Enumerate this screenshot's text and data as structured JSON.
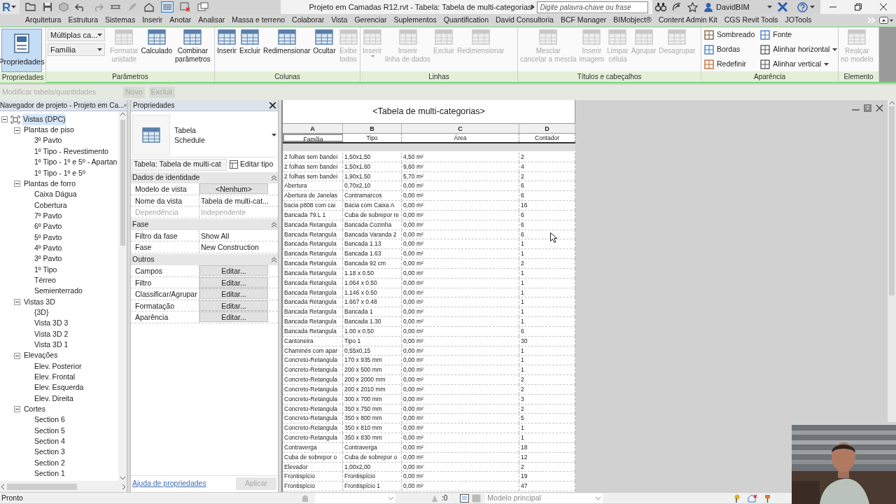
{
  "app_button": {
    "label": "R"
  },
  "window": {
    "title": "Projeto em Camadas R12.rvt - Tabela: Tabela de multi-categorias"
  },
  "search": {
    "placeholder": "Digite palavra-chave ou frase"
  },
  "user": {
    "name": "DavidBIM"
  },
  "ribbon_tabs": [
    "Arquitetura",
    "Estrutura",
    "Sistemas",
    "Inserir",
    "Anotar",
    "Analisar",
    "Massa e terreno",
    "Colaborar",
    "Vista",
    "Gerenciar",
    "Suplementos",
    "Quantification",
    "David Consultoria",
    "BCF Manager",
    "BIMobject®",
    "Content Admin Kit",
    "CGS Revit Tools",
    "JOTools"
  ],
  "ribbon_panels": [
    {
      "title": "Propriedades",
      "tools": [
        {
          "kind": "toggle",
          "label": "Propriedades",
          "on": true
        }
      ]
    },
    {
      "title": "Parâmetros",
      "tools": [
        {
          "kind": "dropdown",
          "value": "Múltiplas ca..."
        },
        {
          "kind": "dropdown",
          "value": "Família"
        },
        {
          "kind": "large",
          "label": "Formatar\nunidade",
          "disabled": true
        },
        {
          "kind": "large",
          "label": "Calculado",
          "disabled": false
        },
        {
          "kind": "large",
          "label": "Combinar\nparâmetros",
          "disabled": false
        }
      ]
    },
    {
      "title": "Colunas",
      "tools": [
        {
          "kind": "large",
          "label": "Inserir",
          "disabled": false
        },
        {
          "kind": "large",
          "label": "Excluir",
          "disabled": false
        },
        {
          "kind": "large",
          "label": "Redimensionar",
          "disabled": false
        },
        {
          "kind": "large",
          "label": "Ocultar",
          "disabled": false
        },
        {
          "kind": "large",
          "label": "Exibir\ntodos",
          "disabled": true
        }
      ]
    },
    {
      "title": "Linhas",
      "tools": [
        {
          "kind": "large_menu",
          "label": "Inserir",
          "disabled": true
        },
        {
          "kind": "large",
          "label": "Inserir\nlinha de dados",
          "disabled": true
        },
        {
          "kind": "large",
          "label": "Excluir",
          "disabled": true
        },
        {
          "kind": "large",
          "label": "Redimensionar",
          "disabled": true
        }
      ]
    },
    {
      "title": "Títulos e cabeçalhos",
      "tools": [
        {
          "kind": "large",
          "label": "Mesclar\ncancelar a mescla",
          "disabled": true
        },
        {
          "kind": "large",
          "label": "Inserir\nimagem",
          "disabled": true
        },
        {
          "kind": "large",
          "label": "Limpar\ncélula",
          "disabled": true
        },
        {
          "kind": "large",
          "label": "Agrupar",
          "disabled": true
        },
        {
          "kind": "large",
          "label": "Desagrupar",
          "disabled": true
        }
      ]
    },
    {
      "title": "Aparência",
      "tools": [
        {
          "kind": "small",
          "label": "Sombreado",
          "caret": false
        },
        {
          "kind": "small",
          "label": "Bordas",
          "caret": false
        },
        {
          "kind": "small",
          "label": "Redefinir",
          "caret": false
        },
        {
          "kind": "small",
          "label": "Fonte",
          "caret": false
        },
        {
          "kind": "small",
          "label": "Alinhar horizontal",
          "caret": true
        },
        {
          "kind": "small",
          "label": "Alinhar vertical",
          "caret": true
        }
      ]
    },
    {
      "title": "Elemento",
      "tools": [
        {
          "kind": "large",
          "label": "Realçar\nno modelo",
          "disabled": true
        }
      ]
    }
  ],
  "context_bar": {
    "title": "Modificar tabela/quantidades",
    "disabled": true,
    "buttons": [
      {
        "label": "Novo",
        "disabled": true
      },
      {
        "label": "Excluir",
        "disabled": true
      }
    ]
  },
  "navigator": {
    "title": "Navegador de projeto - Projeto em Ca...",
    "tree": [
      {
        "label": "Vistas (DPC)",
        "selected": true,
        "expanded": true,
        "children": [
          {
            "label": "Plantas de piso",
            "selected": false,
            "expanded": true,
            "children": [
              {
                "label": "3º Pavto",
                "selected": false
              },
              {
                "label": "1º Tipo - Revestimento",
                "selected": false
              },
              {
                "label": "1º Tipo - 1º e 5º - Apartan",
                "selected": false
              },
              {
                "label": "1º Tipo - 1º e 5º",
                "selected": false
              }
            ]
          },
          {
            "label": "Plantas de forro",
            "selected": false,
            "expanded": true,
            "children": [
              {
                "label": "Caixa Dágua",
                "selected": false
              },
              {
                "label": "Cobertura",
                "selected": false
              },
              {
                "label": "7º Pavto",
                "selected": false
              },
              {
                "label": "6º Pavto",
                "selected": false
              },
              {
                "label": "5º Pavto",
                "selected": false
              },
              {
                "label": "4º Pavto",
                "selected": false
              },
              {
                "label": "3º Pavto",
                "selected": false
              },
              {
                "label": "1º Tipo",
                "selected": false
              },
              {
                "label": "Térreo",
                "selected": false
              },
              {
                "label": "Semienterrado",
                "selected": false
              }
            ]
          },
          {
            "label": "Vistas 3D",
            "selected": false,
            "expanded": true,
            "children": [
              {
                "label": "{3D}",
                "selected": false
              },
              {
                "label": "Vista 3D 3",
                "selected": false
              },
              {
                "label": "Vista 3D 2",
                "selected": false
              },
              {
                "label": "Vista 3D 1",
                "selected": false
              }
            ]
          },
          {
            "label": "Elevações",
            "selected": false,
            "expanded": true,
            "children": [
              {
                "label": "Elev. Posterior",
                "selected": false
              },
              {
                "label": "Elev. Frontal",
                "selected": false
              },
              {
                "label": "Elev. Esquerda",
                "selected": false
              },
              {
                "label": "Elev. Direita",
                "selected": false
              }
            ]
          },
          {
            "label": "Cortes",
            "selected": false,
            "expanded": true,
            "children": [
              {
                "label": "Section 6",
                "selected": false
              },
              {
                "label": "Section 5",
                "selected": false
              },
              {
                "label": "Section 4",
                "selected": false
              },
              {
                "label": "Section 3",
                "selected": false
              },
              {
                "label": "Section 2",
                "selected": false
              },
              {
                "label": "Section 1",
                "selected": false
              }
            ]
          }
        ]
      }
    ]
  },
  "properties": {
    "title": "Propriedades",
    "type_name": "Tabela",
    "type_sub": "Schedule",
    "instance_selector": "Tabela: Tabela de multi-cat",
    "edit_type": "Editar tipo",
    "sections": [
      {
        "title": "Dados de identidade",
        "expanded": true,
        "rows": [
          {
            "label": "Modelo de vista",
            "kind": "button",
            "value": "<Nenhum>",
            "disabled": false
          },
          {
            "label": "Nome da vista",
            "kind": "text",
            "value": "Tabela de multi-cat...",
            "disabled": false
          },
          {
            "label": "Dependência",
            "kind": "text",
            "value": "Independente",
            "disabled": true
          }
        ]
      },
      {
        "title": "Fase",
        "expanded": true,
        "rows": [
          {
            "label": "Filtro da fase",
            "kind": "text",
            "value": "Show All",
            "disabled": false
          },
          {
            "label": "Fase",
            "kind": "text",
            "value": "New Construction",
            "disabled": false
          }
        ]
      },
      {
        "title": "Outros",
        "expanded": true,
        "rows": [
          {
            "label": "Campos",
            "kind": "button",
            "value": "Editar...",
            "disabled": false
          },
          {
            "label": "Filtro",
            "kind": "button",
            "value": "Editar...",
            "disabled": false
          },
          {
            "label": "Classificar/Agrupar",
            "kind": "button",
            "value": "Editar...",
            "disabled": false
          },
          {
            "label": "Formatação",
            "kind": "button",
            "value": "Editar...",
            "disabled": false
          },
          {
            "label": "Aparência",
            "kind": "button",
            "value": "Editar...",
            "disabled": false
          }
        ]
      }
    ],
    "help_link": "Ajuda de propriedades",
    "apply": {
      "label": "Aplicar",
      "disabled": true
    }
  },
  "schedule": {
    "title": "<Tabela de multi-categorias>",
    "columns": [
      {
        "letter": "A",
        "header": "Família"
      },
      {
        "letter": "B",
        "header": "Tipo"
      },
      {
        "letter": "C",
        "header": "Área"
      },
      {
        "letter": "D",
        "header": "Contador"
      }
    ],
    "rows": [
      [
        "2 folhas sem bandei",
        "1,50x1,50",
        "4,50 m²",
        "2"
      ],
      [
        "2 folhas sem bandei",
        "1,50x1,60",
        "9,60 m²",
        "4"
      ],
      [
        "2 folhas sem bandei",
        "1,90x1,50",
        "5,70 m²",
        "2"
      ],
      [
        "Abertura",
        "0,70x2,10",
        "0,00 m²",
        "6"
      ],
      [
        "Abertura de Janelas",
        "Contramarcos",
        "0,00 m²",
        "6"
      ],
      [
        "bacia p808 com cai",
        "Bacia com Caixa A",
        "0,00 m²",
        "16"
      ],
      [
        "Bancada 79.L 1",
        "Cuba de sobrepor re",
        "0,00 m²",
        "6"
      ],
      [
        "Bancada Retangula",
        "Bancada Cozinha",
        "0,00 m²",
        "6"
      ],
      [
        "Bancada Retangula",
        "Bancada Varanda 2",
        "0,00 m²",
        "6"
      ],
      [
        "Bancada Retangula",
        "Bancada 1.13",
        "0,00 m²",
        "1"
      ],
      [
        "Bancada Retangula",
        "Bancada 1.63",
        "0,00 m²",
        "1"
      ],
      [
        "Bancada Retangula",
        "Bancada 92 cm",
        "0,00 m²",
        "2"
      ],
      [
        "Bancada Retangula",
        "1.18 x 0.50",
        "0,00 m²",
        "1"
      ],
      [
        "Bancada Retangula",
        "1.064 x 0.50",
        "0,00 m²",
        "1"
      ],
      [
        "Bancada Retangula",
        "1.146 x 0.50",
        "0,00 m²",
        "1"
      ],
      [
        "Bancada Retangula",
        "1.667 x 0.48",
        "0,00 m²",
        "1"
      ],
      [
        "Bancada Retangula",
        "Bancada 1",
        "0,00 m²",
        "1"
      ],
      [
        "Bancada Retangula",
        "Bancada 1.30",
        "0,00 m²",
        "1"
      ],
      [
        "Bancada Retangula",
        "1.00 x 0.50",
        "0,00 m²",
        "6"
      ],
      [
        "Cantoneira",
        "Tipo 1",
        "0,00 m²",
        "30"
      ],
      [
        "Chaminés com apar",
        "0,55x0,15",
        "0,00 m²",
        "1"
      ],
      [
        "Concreto-Retangula",
        "170 x 935 mm",
        "0,00 m²",
        "1"
      ],
      [
        "Concreto-Retangula",
        "200 x 500 mm",
        "0,00 m²",
        "1"
      ],
      [
        "Concreto-Retangula",
        "200 x 2000 mm",
        "0,00 m²",
        "2"
      ],
      [
        "Concreto-Retangula",
        "200 x 2010 mm",
        "0,00 m²",
        "2"
      ],
      [
        "Concreto-Retangula",
        "300 x 700 mm",
        "0,00 m²",
        "3"
      ],
      [
        "Concreto-Retangula",
        "350 x 750 mm",
        "0,00 m²",
        "2"
      ],
      [
        "Concreto-Retangula",
        "350 x 800 mm",
        "0,00 m²",
        "5"
      ],
      [
        "Concreto-Retangula",
        "350 x 810 mm",
        "0,00 m²",
        "1"
      ],
      [
        "Concreto-Retangula",
        "350 x 830 mm",
        "0,00 m²",
        "1"
      ],
      [
        "Contraverga",
        "Contraverga",
        "0,00 m²",
        "18"
      ],
      [
        "Cuba de sobrepor o",
        "Cuba de sobrepor o",
        "0,00 m²",
        "12"
      ],
      [
        "Elevador",
        "1,00x2,00",
        "0,00 m²",
        "2"
      ],
      [
        "Frontispício",
        "Frontispício",
        "0,00 m²",
        "19"
      ],
      [
        "Frontispício",
        "Frontispício 1",
        "0,00 m²",
        "47"
      ]
    ]
  },
  "status_bar": {
    "text": "Pronto",
    "counter": ":0",
    "model": "Modelo principal"
  }
}
